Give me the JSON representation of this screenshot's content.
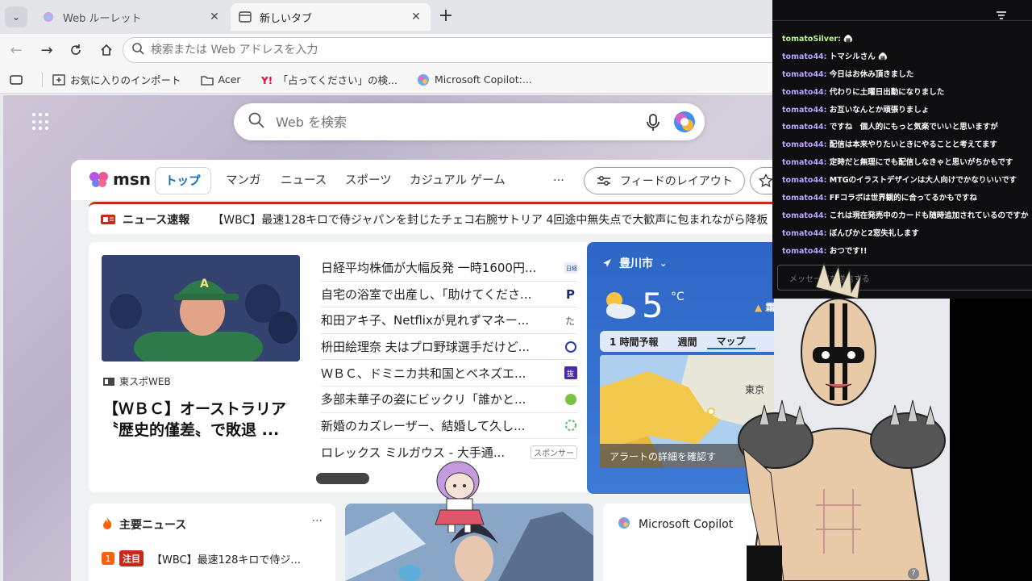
{
  "browser": {
    "tabs": [
      {
        "title": "Web ルーレット",
        "close": "✕"
      },
      {
        "title": "新しいタブ",
        "close": "✕"
      }
    ],
    "new_tab": "+",
    "address_placeholder": "検索または Web アドレスを入力",
    "bookmarks": [
      {
        "label": "お気に入りのインポート",
        "icon": "import-icon"
      },
      {
        "label": "Acer",
        "icon": "folder-icon"
      },
      {
        "label": "「占ってください」の検...",
        "icon": "yahoo-icon"
      },
      {
        "label": "Microsoft Copilot:...",
        "icon": "copilot-icon"
      }
    ]
  },
  "page": {
    "search_placeholder": "Web を検索",
    "msn": {
      "logo": "msn",
      "nav": [
        "トップ",
        "マンガ",
        "ニュース",
        "スポーツ",
        "カジュアル ゲーム"
      ],
      "more": "···",
      "feed_layout": "フィードのレイアウト"
    },
    "breaking": {
      "label": "ニュース速報",
      "text": "【WBC】最速128キロで侍ジャパンを封じたチェコ右腕サトリア 4回途中無失点で大歓声に包まれながら降板"
    },
    "hero": {
      "source": "東スポWEB",
      "title": "【ＷＢＣ】オーストラリア〝歴史的僅差〟で敗退 ..."
    },
    "news": [
      {
        "title": "日経平均株価が大幅反発 一時1600円...",
        "icon": "nikkei-icon"
      },
      {
        "title": "自宅の浴室で出産し、「助けてくださ...",
        "icon": "p-icon"
      },
      {
        "title": "和田アキ子、Netflixが見れずマネー...",
        "icon": "source-icon"
      },
      {
        "title": "枡田絵理奈 夫はプロ野球選手だけど...",
        "icon": "source-icon"
      },
      {
        "title": "ＷＢＣ、ドミニカ共和国とベネズエ...",
        "icon": "source-icon"
      },
      {
        "title": "多部未華子の姿にビックリ「誰かと...",
        "icon": "source-icon"
      },
      {
        "title": "新婚のカズレーザー、結婚して久し...",
        "icon": "source-icon"
      },
      {
        "title": "ロレックス ミルガウス - 大手通...",
        "sponsor": "スポンサー"
      }
    ],
    "weather": {
      "city": "豊川市",
      "temp": "5",
      "unit": "°C",
      "alert": "霜注意報",
      "tabs": [
        "1 時間予報",
        "週間",
        "マップ"
      ],
      "map_label": "東京",
      "alert_button": "アラートの詳細を確認す"
    },
    "top_news": {
      "title": "主要ニュース",
      "more": "···",
      "item_num": "1",
      "item_badge": "注目",
      "item_text": "【WBC】最速128キロで侍ジ..."
    },
    "copilot_card": {
      "title": "Microsoft Copilot"
    }
  },
  "chat": {
    "messages": [
      {
        "user": "tomatoSilver:",
        "text": ""
      },
      {
        "user": "tomato44:",
        "text": "トマシルさん"
      },
      {
        "user": "tomato44:",
        "text": "今日はお休み頂きました"
      },
      {
        "user": "tomato44:",
        "text": "代わりに土曜日出勤になりました"
      },
      {
        "user": "tomato44:",
        "text": "お互いなんとか頑張りましょ"
      },
      {
        "user": "tomato44:",
        "text": "ですね　個人的にもっと気楽でいいと思いますが"
      },
      {
        "user": "tomato44:",
        "text": "配信は本来やりたいときにやることと考えてます"
      },
      {
        "user": "tomato44:",
        "text": "定時だと無理にでも配信しなきゃと思いがちかもです"
      },
      {
        "user": "tomato44:",
        "text": "MTGのイラストデザインは大人向けでかなりいいです"
      },
      {
        "user": "tomato44:",
        "text": "FFコラボは世界観的に合ってるかもですね"
      },
      {
        "user": "tomato44:",
        "text": "これは現在発売中のカードも随時追加されているのですか"
      },
      {
        "user": "tomato44:",
        "text": "ぼんびかと2窓失礼します"
      },
      {
        "user": "tomato44:",
        "text": "おつです!!"
      }
    ],
    "input_placeholder": "メッセージを送信する"
  },
  "colors": {
    "accent": "#0f6cbd",
    "breaking": "#c42b1c",
    "weather": "#2e66c6",
    "chat_user": "#b9a3ff"
  }
}
